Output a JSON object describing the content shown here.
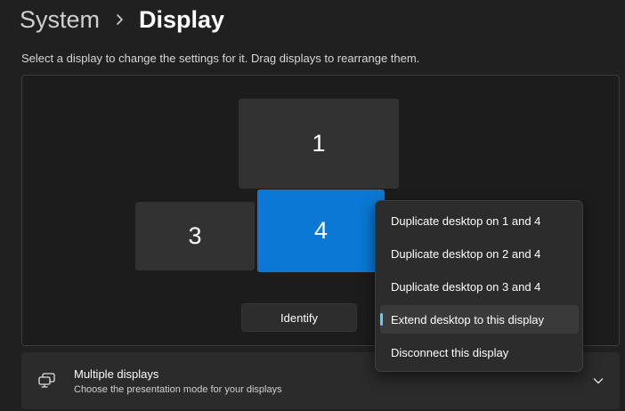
{
  "header": {
    "parent": "System",
    "current": "Display"
  },
  "instruction": "Select a display to change the settings for it. Drag displays to rearrange them.",
  "displays": {
    "display_1": "1",
    "display_3": "3",
    "display_4": "4",
    "selected": "4"
  },
  "identify_label": "Identify",
  "context_menu": {
    "items": [
      "Duplicate desktop on 1 and 4",
      "Duplicate desktop on 2 and 4",
      "Duplicate desktop on 3 and 4",
      "Extend desktop to this display",
      "Disconnect this display"
    ],
    "selected": "Extend desktop to this display"
  },
  "multiple_displays": {
    "title": "Multiple displays",
    "subtitle": "Choose the presentation mode for your displays",
    "icon": "multiple-displays-icon"
  },
  "colors": {
    "accent": "#0a78d4",
    "menu_indicator": "#60cdff",
    "background": "#202020"
  }
}
